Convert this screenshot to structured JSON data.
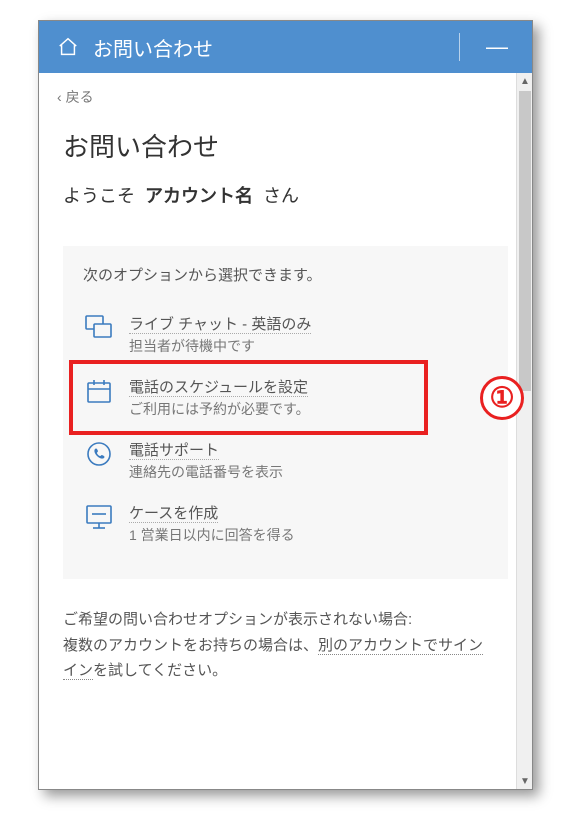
{
  "colors": {
    "titlebar": "#4f8fcf",
    "highlight": "#e92020",
    "icon_blue": "#3b7bbf"
  },
  "titlebar": {
    "title": "お問い合わせ"
  },
  "back": {
    "label": "戻る"
  },
  "header": {
    "heading": "お問い合わせ",
    "welcome_prefix": "ようこそ",
    "account_name": "アカウント名",
    "welcome_suffix": "さん"
  },
  "options": {
    "intro": "次のオプションから選択できます。",
    "items": [
      {
        "icon": "chat-icon",
        "title": "ライブ チャット - 英語のみ",
        "subtitle": "担当者が待機中です"
      },
      {
        "icon": "calendar-icon",
        "title": "電話のスケジュールを設定",
        "subtitle": "ご利用には予約が必要です。",
        "highlighted": true,
        "annotation": "①"
      },
      {
        "icon": "phone-icon",
        "title": "電話サポート",
        "subtitle": "連絡先の電話番号を表示"
      },
      {
        "icon": "case-icon",
        "title": "ケースを作成",
        "subtitle": "1 営業日以内に回答を得る"
      }
    ]
  },
  "footer": {
    "line1": "ご希望の問い合わせオプションが表示されない場合:",
    "line2a": "複数のアカウントをお持ちの場合は、",
    "line2_link": "別のアカウントでサインイン",
    "line2b": "を試してください。"
  }
}
